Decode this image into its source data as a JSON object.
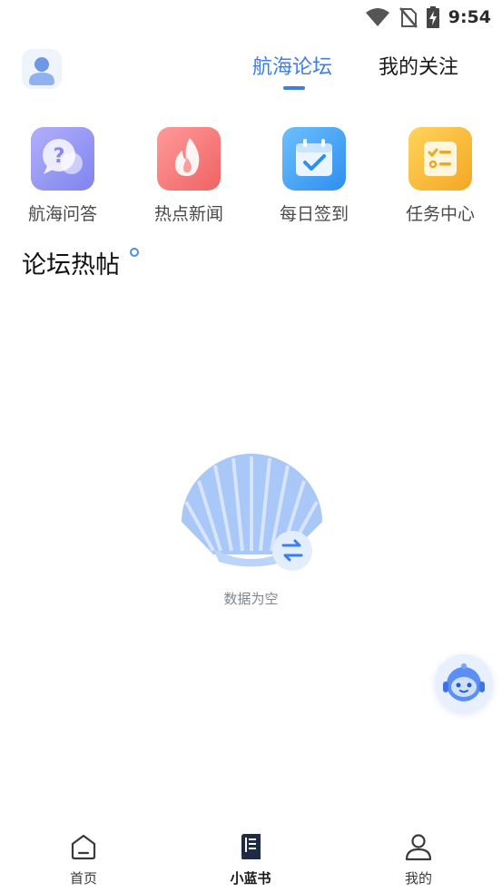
{
  "status_bar": {
    "time": "9:54"
  },
  "header": {
    "tabs": [
      {
        "label": "航海论坛",
        "active": true
      },
      {
        "label": "我的关注",
        "active": false
      }
    ]
  },
  "quick_menu": [
    {
      "label": "航海问答",
      "icon": "qa-bubble-icon",
      "color": "#8f8ff2"
    },
    {
      "label": "热点新闻",
      "icon": "flame-icon",
      "color": "#f36c6c"
    },
    {
      "label": "每日签到",
      "icon": "calendar-check-icon",
      "color": "#3a9af0"
    },
    {
      "label": "任务中心",
      "icon": "task-list-icon",
      "color": "#f7b932"
    }
  ],
  "section": {
    "title": "论坛热帖"
  },
  "empty_state": {
    "text": "数据为空"
  },
  "bottom_nav": [
    {
      "label": "首页",
      "icon": "home-icon",
      "active": false
    },
    {
      "label": "小蓝书",
      "icon": "book-icon",
      "active": true
    },
    {
      "label": "我的",
      "icon": "user-icon",
      "active": false
    }
  ],
  "colors": {
    "accent": "#3f7ee8",
    "shell": "#a9c7f7"
  }
}
